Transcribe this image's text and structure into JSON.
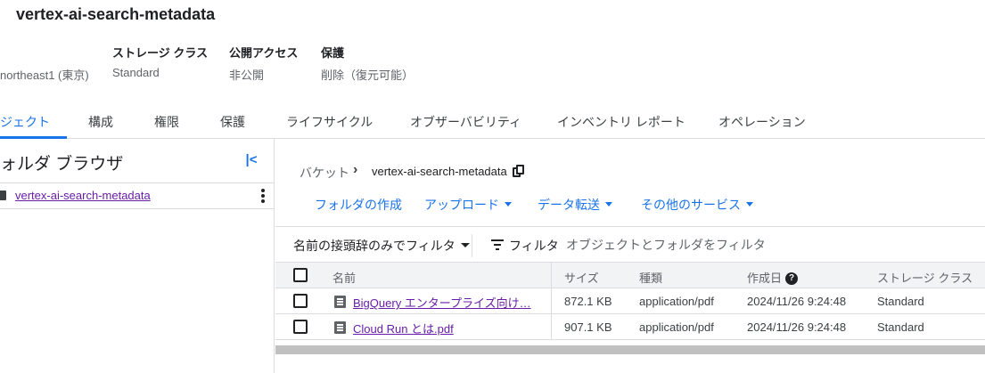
{
  "bucket": {
    "name": "vertex-ai-search-metadata"
  },
  "meta": {
    "location_value": "northeast1 (東京)",
    "storage_class_label": "ストレージ クラス",
    "storage_class_value": "Standard",
    "public_access_label": "公開アクセス",
    "public_access_value": "非公開",
    "protection_label": "保護",
    "protection_value": "削除（復元可能）"
  },
  "tabs": [
    {
      "label": "ジェクト",
      "active": true
    },
    {
      "label": "構成"
    },
    {
      "label": "権限"
    },
    {
      "label": "保護"
    },
    {
      "label": "ライフサイクル"
    },
    {
      "label": "オブザーバビリティ"
    },
    {
      "label": "インベントリ レポート"
    },
    {
      "label": "オペレーション"
    }
  ],
  "folder_browser": {
    "title": "ォルダ ブラウザ",
    "tree_item": "vertex-ai-search-metadata"
  },
  "breadcrumb": {
    "root": "バケット",
    "separator": "›",
    "current": "vertex-ai-search-metadata"
  },
  "actions": {
    "create_folder": "フォルダの作成",
    "upload": "アップロード",
    "transfer": "データ転送",
    "other_services": "その他のサービス"
  },
  "filter": {
    "prefix_label": "名前の接頭辞のみでフィルタ",
    "filter_label": "フィルタ",
    "placeholder": "オブジェクトとフォルダをフィルタ"
  },
  "table": {
    "headers": {
      "name": "名前",
      "size": "サイズ",
      "type": "種類",
      "created": "作成日",
      "storage_class": "ストレージ クラス"
    },
    "rows": [
      {
        "name": "BigQuery エンタープライズ向け…",
        "size": "872.1 KB",
        "type": "application/pdf",
        "created": "2024/11/26 9:24:48",
        "storage_class": "Standard"
      },
      {
        "name": "Cloud Run とは.pdf",
        "size": "907.1 KB",
        "type": "application/pdf",
        "created": "2024/11/26 9:24:48",
        "storage_class": "Standard"
      }
    ]
  },
  "colors": {
    "accent": "#1a73e8",
    "visited_link": "#681da8",
    "border": "#dadce0",
    "header_bg": "#f1f3f4"
  }
}
